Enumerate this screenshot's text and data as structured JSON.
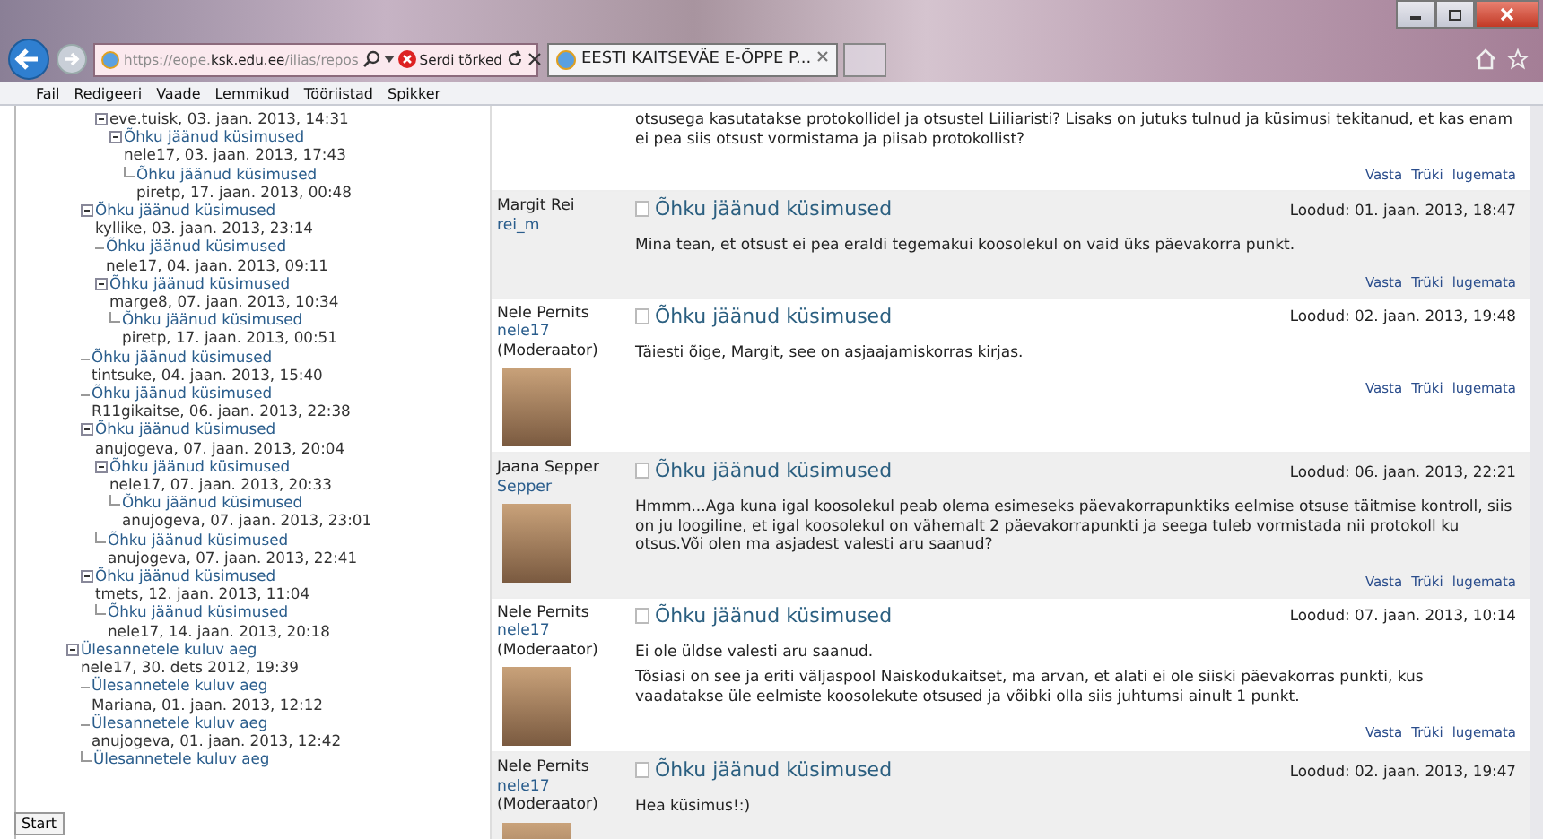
{
  "browser": {
    "address": "https://eope.**ksk.edu.ee**/ilias/repos",
    "cert_error": "Serdi tõrked",
    "tabs": [
      {
        "label": "EESTI KAITSEVÄE E-ÕPPE P...",
        "selected": true
      }
    ]
  },
  "menu": [
    "Fail",
    "Redigeeri",
    "Vaade",
    "Lemmikud",
    "Tööriistad",
    "Spikker"
  ],
  "tree": [
    {
      "children": [
        {
          "children": [
            {
              "meta": "eve.tuisk, 03. jaan. 2013, 14:31",
              "children": [
                {
                  "title": "Õhku jäänud küsimused",
                  "meta": "nele17, 03. jaan. 2013, 17:43",
                  "children": [
                    {
                      "title": "Õhku jäänud küsimused",
                      "meta": "piretp, 17. jaan. 2013, 00:48"
                    }
                  ]
                }
              ]
            }
          ]
        },
        {
          "title": "Õhku jäänud küsimused",
          "meta": "kyllike, 03. jaan. 2013, 23:14",
          "children": [
            {
              "title": "Õhku jäänud küsimused",
              "meta": "nele17, 04. jaan. 2013, 09:11"
            },
            {
              "title": "Õhku jäänud küsimused",
              "meta": "marge8, 07. jaan. 2013, 10:34",
              "children": [
                {
                  "title": "Õhku jäänud küsimused",
                  "meta": "piretp, 17. jaan. 2013, 00:51"
                }
              ]
            }
          ]
        },
        {
          "title": "Õhku jäänud küsimused",
          "meta": "tintsuke, 04. jaan. 2013, 15:40"
        },
        {
          "title": "Õhku jäänud küsimused",
          "meta": "R11gikaitse, 06. jaan. 2013, 22:38"
        },
        {
          "title": "Õhku jäänud küsimused",
          "meta": "anujogeva, 07. jaan. 2013, 20:04",
          "children": [
            {
              "title": "Õhku jäänud küsimused",
              "meta": "nele17, 07. jaan. 2013, 20:33",
              "children": [
                {
                  "title": "Õhku jäänud küsimused",
                  "meta": "anujogeva, 07. jaan. 2013, 23:01"
                }
              ]
            },
            {
              "title": "Õhku jäänud küsimused",
              "meta": "anujogeva, 07. jaan. 2013, 22:41"
            }
          ]
        },
        {
          "title": "Õhku jäänud küsimused",
          "meta": "tmets, 12. jaan. 2013, 11:04",
          "children": [
            {
              "title": "Õhku jäänud küsimused",
              "meta": "nele17, 14. jaan. 2013, 20:18"
            }
          ]
        }
      ]
    },
    {
      "title": "Ülesannetele kuluv aeg",
      "meta": "nele17, 30. dets 2012, 19:39",
      "children": [
        {
          "title": "Ülesannetele kuluv aeg",
          "meta": "Mariana, 01. jaan. 2013, 12:12"
        },
        {
          "title": "Ülesannetele kuluv aeg",
          "meta": "anujogeva, 01. jaan. 2013, 12:42"
        },
        {
          "title": "Ülesannetele kuluv aeg"
        }
      ]
    }
  ],
  "posts": [
    {
      "shaded": false,
      "photo": false,
      "body": [
        "otsusega kasutatakse protokollidel ja otsustel Liiliaristi? Lisaks on jutuks tulnud ja küsimusi tekitanud, et kas enam ei pea siis otsust vormistama ja piisab protokollist?"
      ],
      "actions": [
        "Vasta",
        "Trüki",
        "lugemata"
      ]
    },
    {
      "shaded": true,
      "photo": false,
      "author": "Margit Rei",
      "checked": false,
      "login": "rei_m",
      "title": "Õhku jäänud küsimused",
      "created": "Loodud: 01. jaan. 2013, 18:47",
      "body": [
        "Mina tean, et otsust ei pea eraldi tegemakui koosolekul on vaid üks päevakorra punkt."
      ],
      "actions": [
        "Vasta",
        "Trüki",
        "lugemata"
      ]
    },
    {
      "shaded": false,
      "photo": true,
      "author": "Nele Pernits",
      "login": "nele17",
      "role": "(Moderaator)",
      "checked": false,
      "title": "Õhku jäänud küsimused",
      "created": "Loodud: 02. jaan. 2013, 19:48",
      "body": [
        "Täiesti õige, Margit, see on asjaajamiskorras kirjas."
      ],
      "actions": [
        "Vasta",
        "Trüki",
        "lugemata"
      ]
    },
    {
      "shaded": true,
      "photo": true,
      "author": "Jaana Sepper",
      "checked": false,
      "login": "Sepper",
      "title": "Õhku jäänud küsimused",
      "created": "Loodud: 06. jaan. 2013, 22:21",
      "body": [
        "Hmmm...Aga kuna igal koosolekul peab olema esimeseks päevakorrapunktiks eelmise otsuse täitmise kontroll, siis on ju loogiline, et igal koosolekul on vähemalt 2 päevakorrapunkti ja seega tuleb vormistada nii protokoll ku otsus.Või olen ma asjadest valesti aru saanud?"
      ],
      "actions": [
        "Vasta",
        "Trüki",
        "lugemata"
      ]
    },
    {
      "shaded": false,
      "photo": true,
      "author": "Nele Pernits",
      "login": "nele17",
      "role": "(Moderaator)",
      "checked": false,
      "title": "Õhku jäänud küsimused",
      "created": "Loodud: 07. jaan. 2013, 10:14",
      "body": [
        "Ei ole üldse valesti aru saanud.",
        "Tõsiasi on see ja eriti väljaspool Naiskodukaitset, ma arvan, et alati ei ole siiski päevakorras punkti, kus vaadatakse üle eelmiste koosolekute otsused ja võibki olla siis juhtumsi ainult 1 punkt."
      ],
      "actions": [
        "Vasta",
        "Trüki",
        "lugemata"
      ]
    },
    {
      "shaded": true,
      "photo": true,
      "author": "Nele Pernits",
      "login": "nele17",
      "role": "(Moderaator)",
      "checked": false,
      "title": "Õhku jäänud küsimused",
      "created": "Loodud: 02. jaan. 2013, 19:47",
      "body": [
        "Hea küsimus!:)"
      ]
    }
  ],
  "start_button": "Start"
}
